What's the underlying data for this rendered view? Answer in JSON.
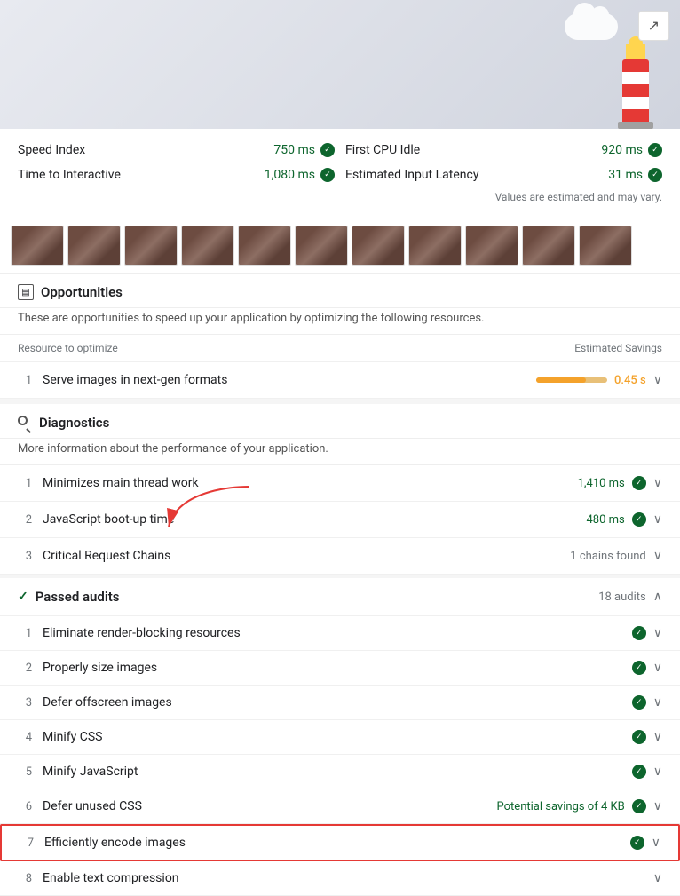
{
  "header": {
    "share_label": "↗"
  },
  "metrics": {
    "speed_index_label": "Speed Index",
    "speed_index_value": "750 ms",
    "first_cpu_idle_label": "First CPU Idle",
    "first_cpu_idle_value": "920 ms",
    "time_to_interactive_label": "Time to Interactive",
    "time_to_interactive_value": "1,080 ms",
    "estimated_input_latency_label": "Estimated Input Latency",
    "estimated_input_latency_value": "31 ms",
    "values_note": "Values are estimated and may vary."
  },
  "opportunities": {
    "title": "Opportunities",
    "description": "These are opportunities to speed up your application by optimizing the following resources.",
    "col_resource": "Resource to optimize",
    "col_savings": "Estimated Savings",
    "items": [
      {
        "num": "1",
        "label": "Serve images in next-gen formats",
        "savings": "0.45 s",
        "bar_fill": 70
      }
    ]
  },
  "diagnostics": {
    "title": "Diagnostics",
    "description": "More information about the performance of your application.",
    "items": [
      {
        "num": "1",
        "label": "Minimizes main thread work",
        "value": "1,410 ms",
        "has_check": true
      },
      {
        "num": "2",
        "label": "JavaScript boot-up time",
        "value": "480 ms",
        "has_check": true
      },
      {
        "num": "3",
        "label": "Critical Request Chains",
        "value": "1 chains found",
        "has_check": false
      }
    ]
  },
  "passed_audits": {
    "title": "Passed audits",
    "count": "18 audits",
    "items": [
      {
        "num": "1",
        "label": "Eliminate render-blocking resources",
        "potential": "",
        "highlighted": false
      },
      {
        "num": "2",
        "label": "Properly size images",
        "potential": "",
        "highlighted": false
      },
      {
        "num": "3",
        "label": "Defer offscreen images",
        "potential": "",
        "highlighted": false
      },
      {
        "num": "4",
        "label": "Minify CSS",
        "potential": "",
        "highlighted": false
      },
      {
        "num": "5",
        "label": "Minify JavaScript",
        "potential": "",
        "highlighted": false
      },
      {
        "num": "6",
        "label": "Defer unused CSS",
        "potential": "Potential savings of 4 KB",
        "highlighted": false
      },
      {
        "num": "7",
        "label": "Efficiently encode images",
        "potential": "",
        "highlighted": true
      },
      {
        "num": "8",
        "label": "Enable text compression",
        "potential": "",
        "highlighted": false
      }
    ]
  }
}
